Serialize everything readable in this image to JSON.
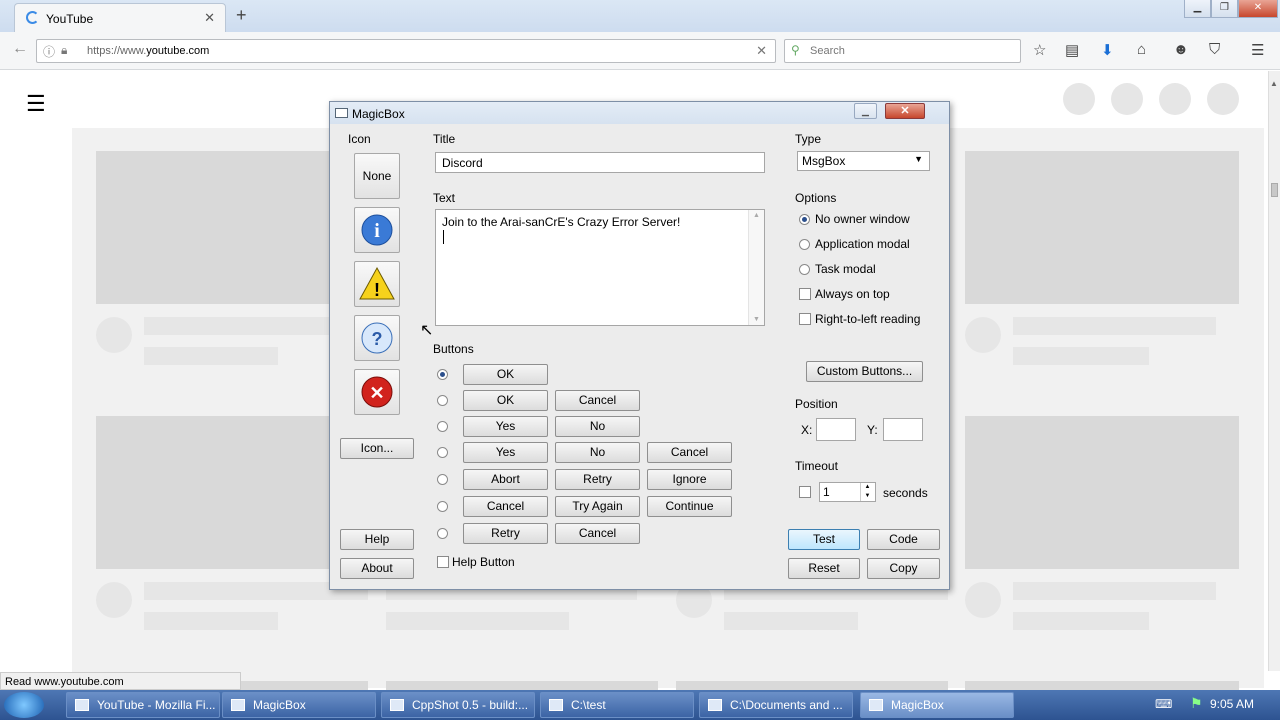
{
  "browser": {
    "tab_title": "YouTube",
    "url_prefix": "https://www.",
    "url_domain": "youtube.com",
    "search_placeholder": "Search",
    "status_text": "Read www.youtube.com"
  },
  "dialog": {
    "title": "MagicBox",
    "icon_section_label": "Icon",
    "icon_none_label": "None",
    "icon_button_label": "Icon...",
    "help_label": "Help",
    "about_label": "About",
    "title_label": "Title",
    "title_value": "Discord",
    "text_label": "Text",
    "text_value": "Join to the Arai-sanCrE's Crazy Error Server!",
    "buttons_label": "Buttons",
    "button_rows": [
      [
        "OK"
      ],
      [
        "OK",
        "Cancel"
      ],
      [
        "Yes",
        "No"
      ],
      [
        "Yes",
        "No",
        "Cancel"
      ],
      [
        "Abort",
        "Retry",
        "Ignore"
      ],
      [
        "Cancel",
        "Try Again",
        "Continue"
      ],
      [
        "Retry",
        "Cancel"
      ]
    ],
    "help_button_label": "Help Button",
    "type_label": "Type",
    "type_value": "MsgBox",
    "options_label": "Options",
    "options": [
      "No owner window",
      "Application modal",
      "Task modal"
    ],
    "checks": [
      "Always on top",
      "Right-to-left reading"
    ],
    "custom_buttons_label": "Custom Buttons...",
    "position_label": "Position",
    "x_label": "X:",
    "y_label": "Y:",
    "timeout_label": "Timeout",
    "timeout_value": "1",
    "seconds_label": "seconds",
    "test_label": "Test",
    "code_label": "Code",
    "reset_label": "Reset",
    "copy_label": "Copy"
  },
  "taskbar": {
    "items": [
      "YouTube - Mozilla Fi...",
      "MagicBox",
      "CppShot 0.5 - build:...",
      "C:\\test",
      "C:\\Documents and ...",
      "MagicBox"
    ],
    "clock": "9:05 AM"
  }
}
